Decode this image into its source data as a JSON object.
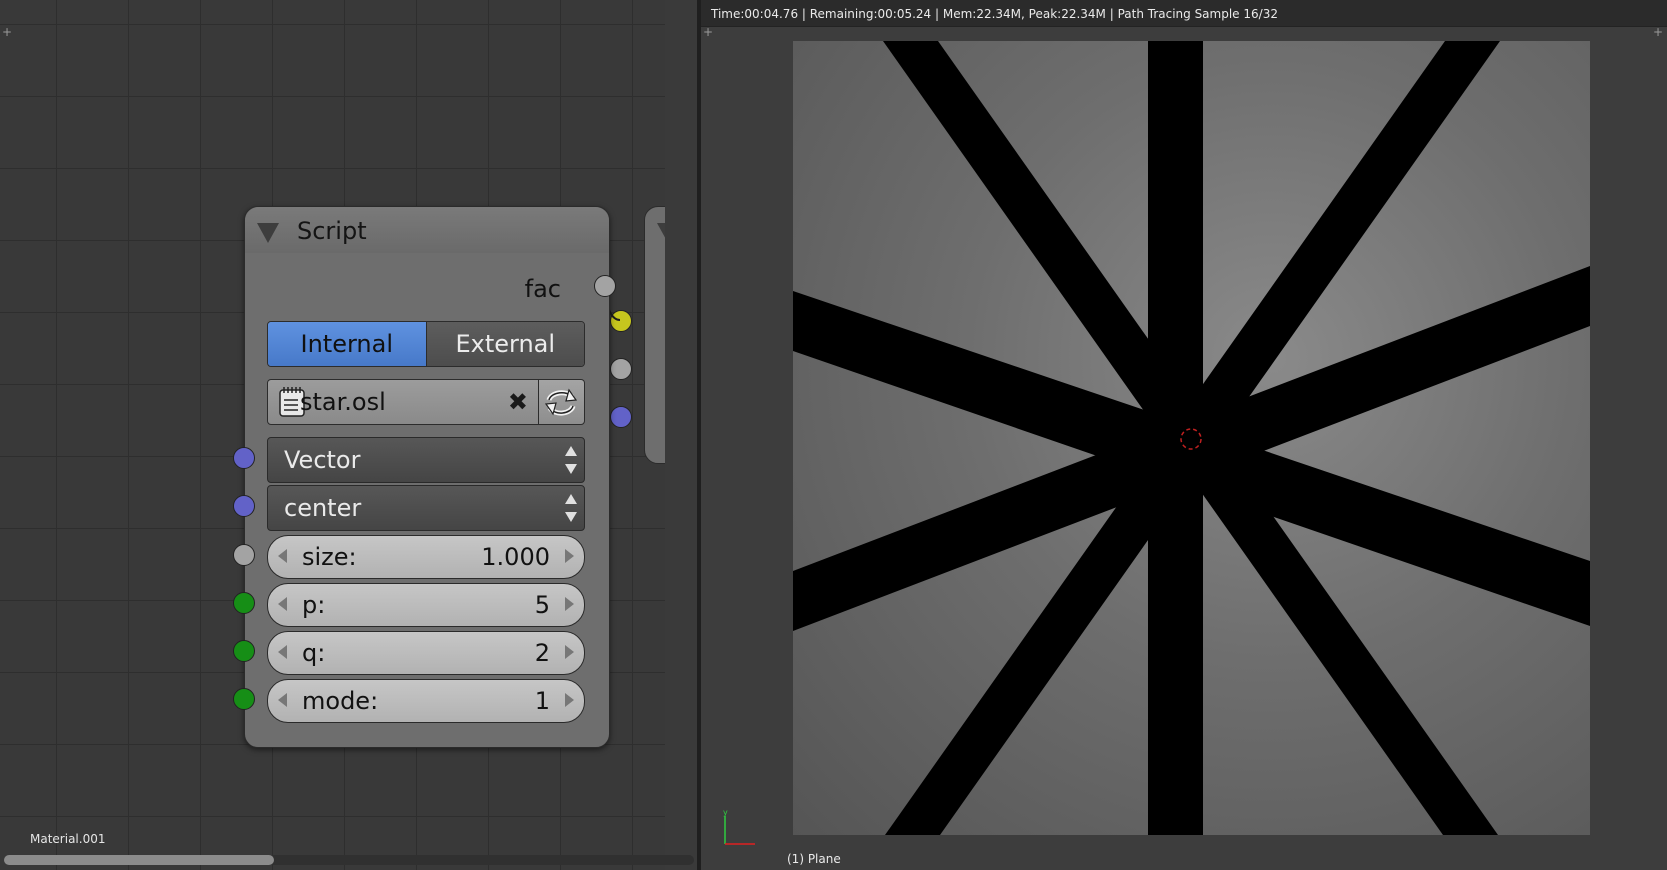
{
  "render_stats": "Time:00:04.76 | Remaining:00:05.24 | Mem:22.34M, Peak:22.34M | Path Tracing Sample 16/32",
  "material_name": "Material.001",
  "object_label": "(1) Plane",
  "script_node": {
    "title": "Script",
    "output_label": "fac",
    "mode_internal": "Internal",
    "mode_external": "External",
    "script_name": "star.osl",
    "clear_symbol": "✖",
    "vector_dropdown": "Vector",
    "center_dropdown": "center",
    "fields": [
      {
        "label": "size:",
        "value": "1.000"
      },
      {
        "label": "p:",
        "value": "5"
      },
      {
        "label": "q:",
        "value": "2"
      },
      {
        "label": "mode:",
        "value": "1"
      }
    ]
  },
  "colors": {
    "internal_active": "#5a8dda",
    "socket_grey": "#a3a3a3",
    "socket_violet": "#6262c8",
    "socket_green": "#168e16",
    "socket_yellow": "#c6c61e"
  },
  "icons": {
    "text_icon": "text-document-icon",
    "reload_icon": "reload-icon",
    "dropdown_arrows": "up-down-arrows-icon"
  }
}
